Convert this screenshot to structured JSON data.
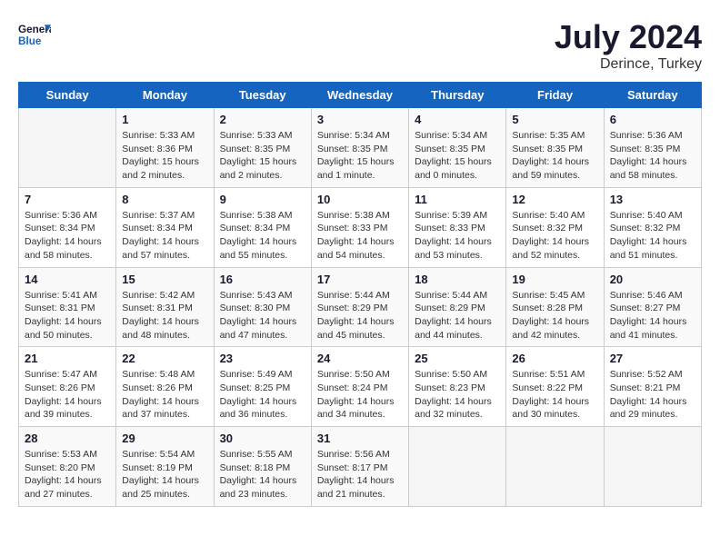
{
  "header": {
    "logo_general": "General",
    "logo_blue": "Blue",
    "month_year": "July 2024",
    "location": "Derince, Turkey"
  },
  "columns": [
    "Sunday",
    "Monday",
    "Tuesday",
    "Wednesday",
    "Thursday",
    "Friday",
    "Saturday"
  ],
  "weeks": [
    [
      {
        "day": "",
        "info": ""
      },
      {
        "day": "1",
        "info": "Sunrise: 5:33 AM\nSunset: 8:36 PM\nDaylight: 15 hours\nand 2 minutes."
      },
      {
        "day": "2",
        "info": "Sunrise: 5:33 AM\nSunset: 8:35 PM\nDaylight: 15 hours\nand 2 minutes."
      },
      {
        "day": "3",
        "info": "Sunrise: 5:34 AM\nSunset: 8:35 PM\nDaylight: 15 hours\nand 1 minute."
      },
      {
        "day": "4",
        "info": "Sunrise: 5:34 AM\nSunset: 8:35 PM\nDaylight: 15 hours\nand 0 minutes."
      },
      {
        "day": "5",
        "info": "Sunrise: 5:35 AM\nSunset: 8:35 PM\nDaylight: 14 hours\nand 59 minutes."
      },
      {
        "day": "6",
        "info": "Sunrise: 5:36 AM\nSunset: 8:35 PM\nDaylight: 14 hours\nand 58 minutes."
      }
    ],
    [
      {
        "day": "7",
        "info": "Sunrise: 5:36 AM\nSunset: 8:34 PM\nDaylight: 14 hours\nand 58 minutes."
      },
      {
        "day": "8",
        "info": "Sunrise: 5:37 AM\nSunset: 8:34 PM\nDaylight: 14 hours\nand 57 minutes."
      },
      {
        "day": "9",
        "info": "Sunrise: 5:38 AM\nSunset: 8:34 PM\nDaylight: 14 hours\nand 55 minutes."
      },
      {
        "day": "10",
        "info": "Sunrise: 5:38 AM\nSunset: 8:33 PM\nDaylight: 14 hours\nand 54 minutes."
      },
      {
        "day": "11",
        "info": "Sunrise: 5:39 AM\nSunset: 8:33 PM\nDaylight: 14 hours\nand 53 minutes."
      },
      {
        "day": "12",
        "info": "Sunrise: 5:40 AM\nSunset: 8:32 PM\nDaylight: 14 hours\nand 52 minutes."
      },
      {
        "day": "13",
        "info": "Sunrise: 5:40 AM\nSunset: 8:32 PM\nDaylight: 14 hours\nand 51 minutes."
      }
    ],
    [
      {
        "day": "14",
        "info": "Sunrise: 5:41 AM\nSunset: 8:31 PM\nDaylight: 14 hours\nand 50 minutes."
      },
      {
        "day": "15",
        "info": "Sunrise: 5:42 AM\nSunset: 8:31 PM\nDaylight: 14 hours\nand 48 minutes."
      },
      {
        "day": "16",
        "info": "Sunrise: 5:43 AM\nSunset: 8:30 PM\nDaylight: 14 hours\nand 47 minutes."
      },
      {
        "day": "17",
        "info": "Sunrise: 5:44 AM\nSunset: 8:29 PM\nDaylight: 14 hours\nand 45 minutes."
      },
      {
        "day": "18",
        "info": "Sunrise: 5:44 AM\nSunset: 8:29 PM\nDaylight: 14 hours\nand 44 minutes."
      },
      {
        "day": "19",
        "info": "Sunrise: 5:45 AM\nSunset: 8:28 PM\nDaylight: 14 hours\nand 42 minutes."
      },
      {
        "day": "20",
        "info": "Sunrise: 5:46 AM\nSunset: 8:27 PM\nDaylight: 14 hours\nand 41 minutes."
      }
    ],
    [
      {
        "day": "21",
        "info": "Sunrise: 5:47 AM\nSunset: 8:26 PM\nDaylight: 14 hours\nand 39 minutes."
      },
      {
        "day": "22",
        "info": "Sunrise: 5:48 AM\nSunset: 8:26 PM\nDaylight: 14 hours\nand 37 minutes."
      },
      {
        "day": "23",
        "info": "Sunrise: 5:49 AM\nSunset: 8:25 PM\nDaylight: 14 hours\nand 36 minutes."
      },
      {
        "day": "24",
        "info": "Sunrise: 5:50 AM\nSunset: 8:24 PM\nDaylight: 14 hours\nand 34 minutes."
      },
      {
        "day": "25",
        "info": "Sunrise: 5:50 AM\nSunset: 8:23 PM\nDaylight: 14 hours\nand 32 minutes."
      },
      {
        "day": "26",
        "info": "Sunrise: 5:51 AM\nSunset: 8:22 PM\nDaylight: 14 hours\nand 30 minutes."
      },
      {
        "day": "27",
        "info": "Sunrise: 5:52 AM\nSunset: 8:21 PM\nDaylight: 14 hours\nand 29 minutes."
      }
    ],
    [
      {
        "day": "28",
        "info": "Sunrise: 5:53 AM\nSunset: 8:20 PM\nDaylight: 14 hours\nand 27 minutes."
      },
      {
        "day": "29",
        "info": "Sunrise: 5:54 AM\nSunset: 8:19 PM\nDaylight: 14 hours\nand 25 minutes."
      },
      {
        "day": "30",
        "info": "Sunrise: 5:55 AM\nSunset: 8:18 PM\nDaylight: 14 hours\nand 23 minutes."
      },
      {
        "day": "31",
        "info": "Sunrise: 5:56 AM\nSunset: 8:17 PM\nDaylight: 14 hours\nand 21 minutes."
      },
      {
        "day": "",
        "info": ""
      },
      {
        "day": "",
        "info": ""
      },
      {
        "day": "",
        "info": ""
      }
    ]
  ]
}
